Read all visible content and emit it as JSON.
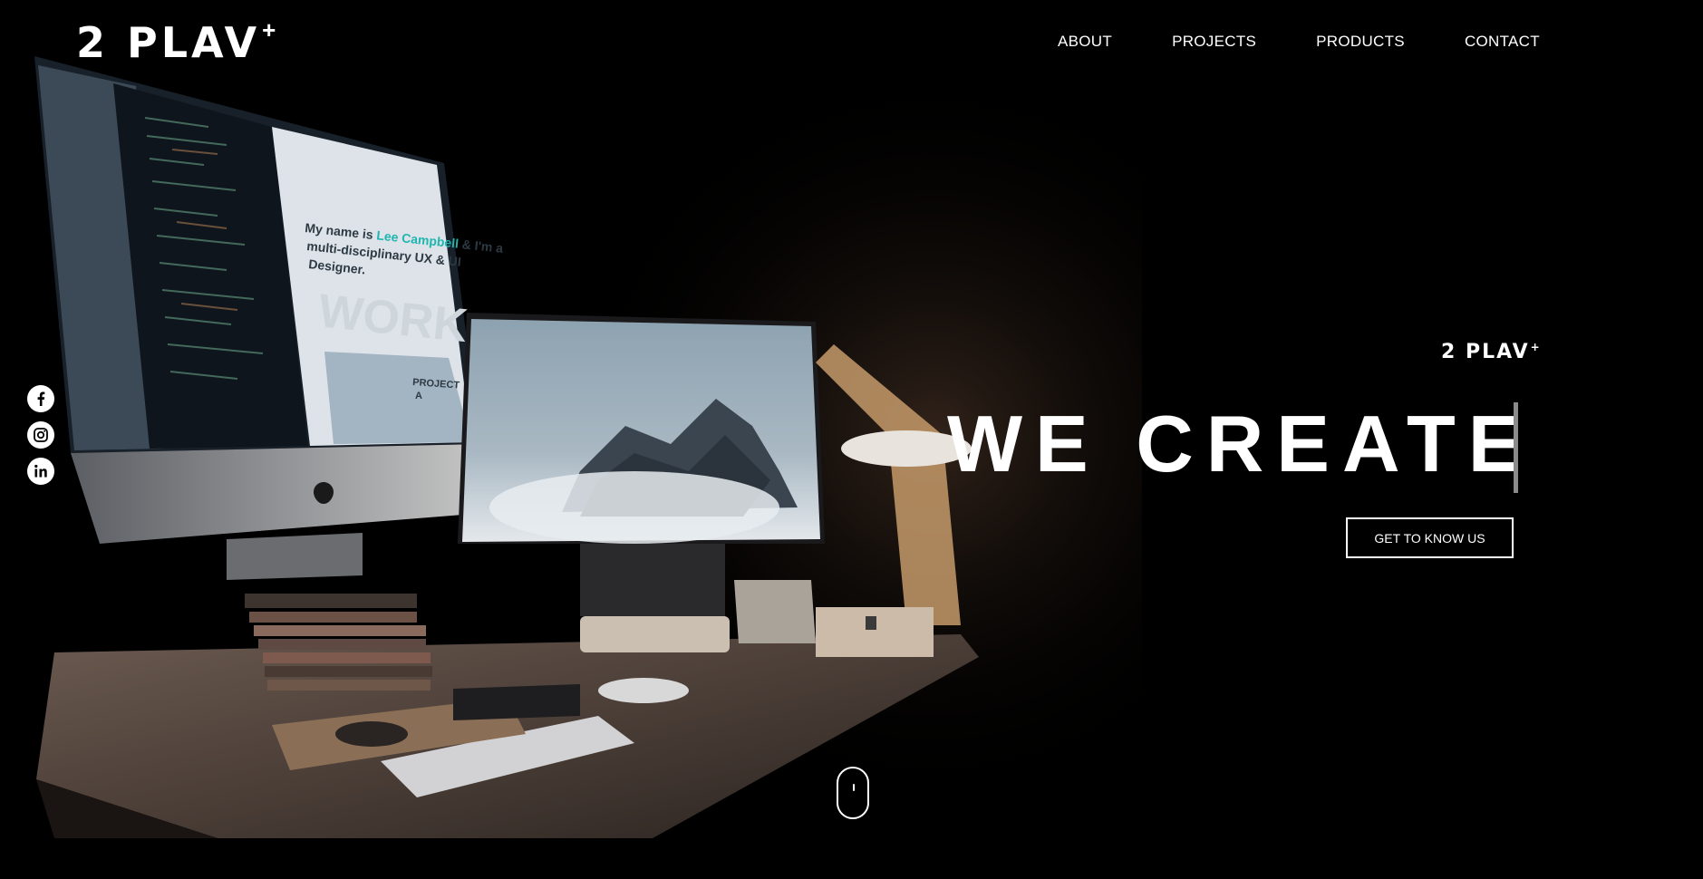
{
  "brand": {
    "logo_text": "2 PLAV",
    "logo_plus": "+"
  },
  "nav": {
    "items": [
      {
        "label": "ABOUT"
      },
      {
        "label": "PROJECTS"
      },
      {
        "label": "PRODUCTS"
      },
      {
        "label": "CONTACT"
      }
    ]
  },
  "social": {
    "items": [
      {
        "icon": "facebook-icon"
      },
      {
        "icon": "instagram-icon"
      },
      {
        "icon": "linkedin-icon"
      }
    ]
  },
  "hero": {
    "small_logo": "2 PLAV",
    "small_logo_plus": "+",
    "headline": "WE CREATE",
    "cta_label": "GET TO KNOW US",
    "screen_text": {
      "line1_a": "My name is ",
      "line1_name": "Lee Campbell",
      "line1_b": " & I'm a",
      "line2": "multi-disciplinary UX & UI",
      "line3": "Designer.",
      "work": "WORK",
      "project_label": "PROJECT",
      "project_sub": "A"
    }
  },
  "colors": {
    "background": "#000000",
    "text": "#ffffff",
    "accent_cursor": "#8a8a8a",
    "screen_name": "#1fb6b0"
  }
}
